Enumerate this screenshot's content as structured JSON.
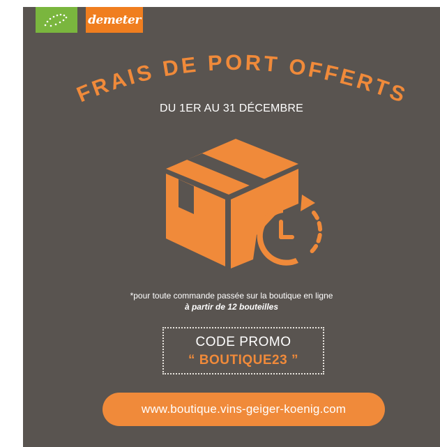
{
  "logos": {
    "left_logo_icon": "eu-organic-leaf-icon",
    "right_logo_text": "demeter"
  },
  "headline": {
    "text": "FRAIS DE PORT OFFERTS",
    "color": "#f08a3a"
  },
  "dates": "DU 1ER AU 31 DÉCEMBRE",
  "illustration": {
    "icon": "delivery-box-clock-icon",
    "color": "#f08a3a"
  },
  "conditions": {
    "line1": "*pour toute commande passée sur la boutique en ligne",
    "line2": "à partir de 12 bouteilles"
  },
  "promo": {
    "label": "CODE PROMO",
    "code": "“ BOUTIQUE23 ”"
  },
  "website": "www.boutique.vins-geiger-koenig.com",
  "colors": {
    "background": "#595450",
    "accent": "#f08a3a",
    "organic_green": "#7ab63e",
    "text": "#ffffff"
  }
}
